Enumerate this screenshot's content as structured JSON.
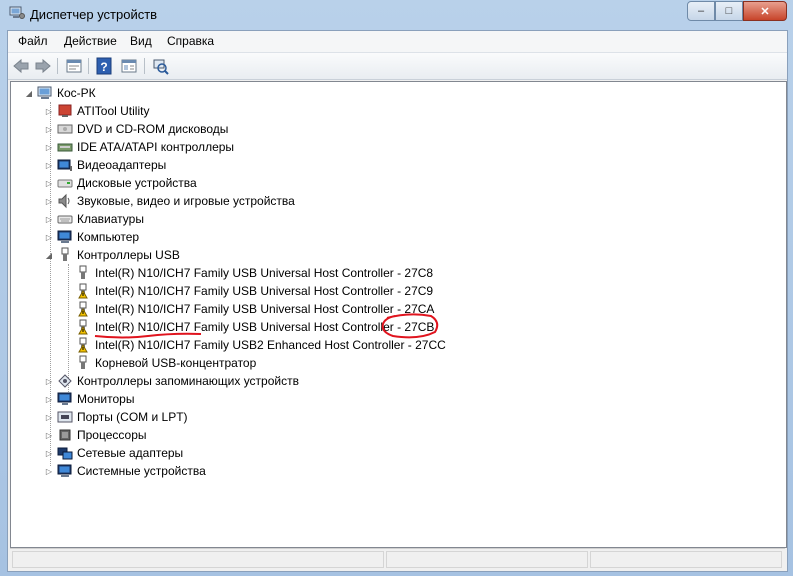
{
  "window": {
    "title": "Диспетчер устройств",
    "min": "–",
    "max": "□",
    "close": "✕"
  },
  "menu": [
    "Файл",
    "Действие",
    "Вид",
    "Справка"
  ],
  "toolbar": {
    "icons": [
      "back-icon",
      "forward-icon",
      "properties-icon",
      "help-icon",
      "view-icon",
      "scan-hardware-icon"
    ]
  },
  "tree": {
    "root": "Кос-РК",
    "categories": [
      {
        "label": "ATITool Utility",
        "icon": "ati-icon"
      },
      {
        "label": "DVD и CD-ROM дисководы",
        "icon": "dvd-icon"
      },
      {
        "label": "IDE ATA/ATAPI контроллеры",
        "icon": "ide-icon"
      },
      {
        "label": "Видеоадаптеры",
        "icon": "display-adapter-icon"
      },
      {
        "label": "Дисковые устройства",
        "icon": "disk-icon"
      },
      {
        "label": "Звуковые, видео и игровые устройства",
        "icon": "sound-icon"
      },
      {
        "label": "Клавиатуры",
        "icon": "keyboard-icon"
      },
      {
        "label": "Компьютер",
        "icon": "computer-icon"
      },
      {
        "label": "Контроллеры USB",
        "icon": "usb-icon",
        "expanded": true
      }
    ],
    "usb_children": [
      {
        "label": "Intel(R) N10/ICH7 Family USB Universal Host Controller - 27C8",
        "warning": false
      },
      {
        "label": "Intel(R) N10/ICH7 Family USB Universal Host Controller - 27C9",
        "warning": true
      },
      {
        "label": "Intel(R) N10/ICH7 Family USB Universal Host Controller - 27CA",
        "warning": true
      },
      {
        "label": "Intel(R) N10/ICH7 Family USB Universal Host Controller - 27CB",
        "warning": true
      },
      {
        "label": "Intel(R) N10/ICH7 Family USB2 Enhanced Host Controller - 27CC",
        "warning": true
      },
      {
        "label": "Корневой USB-концентратор",
        "warning": false
      }
    ],
    "categories_after": [
      {
        "label": "Контроллеры запоминающих устройств",
        "icon": "storage-controller-icon"
      },
      {
        "label": "Мониторы",
        "icon": "monitor-icon"
      },
      {
        "label": "Порты (COM и LPT)",
        "icon": "port-icon"
      },
      {
        "label": "Процессоры",
        "icon": "processor-icon"
      },
      {
        "label": "Сетевые адаптеры",
        "icon": "network-icon"
      },
      {
        "label": "Системные устройства",
        "icon": "system-icon"
      }
    ]
  },
  "colors": {
    "annotation": "#e0141e",
    "window_frame": "#b9d1ea"
  }
}
